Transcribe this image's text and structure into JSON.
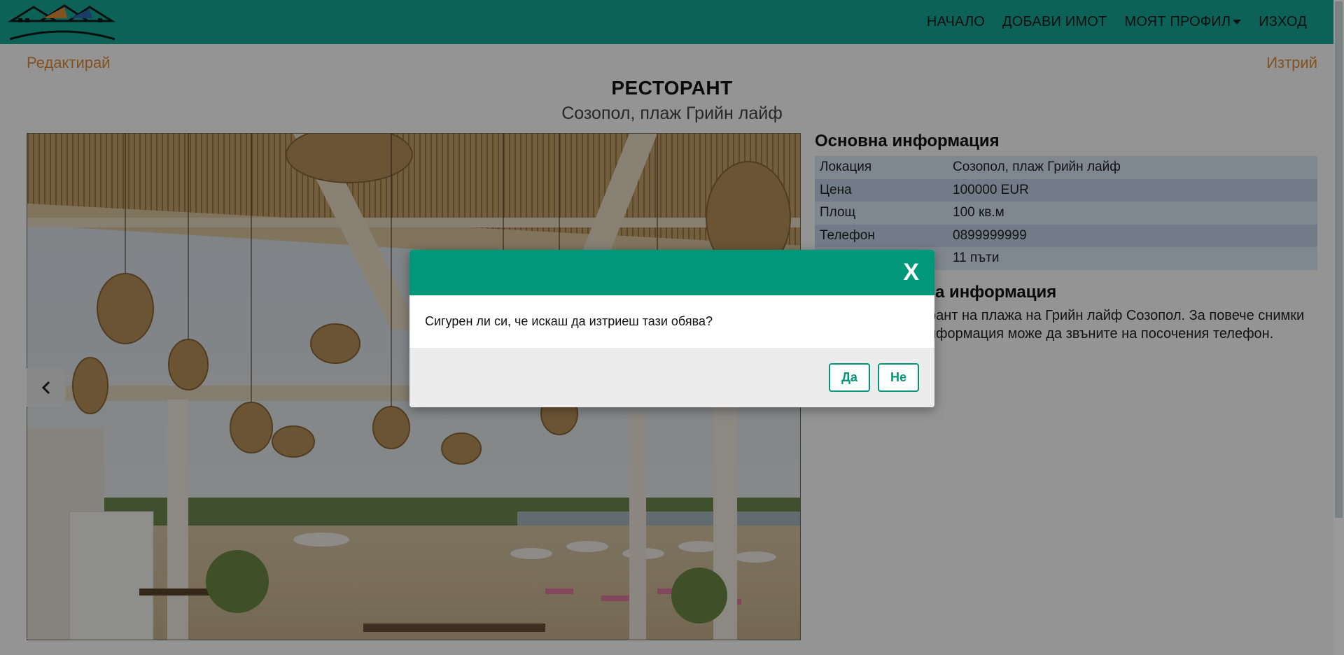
{
  "navbar": {
    "links": [
      "НАЧАЛО",
      "ДОБАВИ ИМОТ",
      "МОЯТ ПРОФИЛ",
      "ИЗХОД"
    ]
  },
  "actions": {
    "edit": "Редактирай",
    "delete": "Изтрий"
  },
  "listing": {
    "title": "РЕСТОРАНТ",
    "subtitle": "Созопол, плаж Грийн лайф"
  },
  "info": {
    "heading": "Основна информация",
    "rows": [
      {
        "key": "Локация",
        "value": "Созопол, плаж Грийн лайф"
      },
      {
        "key": "Цена",
        "value": "100000 EUR"
      },
      {
        "key": "Площ",
        "value": "100 кв.м"
      },
      {
        "key": "Телефон",
        "value": "0899999999"
      },
      {
        "key": "",
        "value": "11 пъти"
      }
    ],
    "second_heading": "а информация",
    "description_lines": [
      "рант на плажа на Грийн лайф Созопол. За повече снимки",
      "нформация може да звъните на посочения телефон."
    ]
  },
  "modal": {
    "close": "X",
    "message": "Сигурен ли си, че искаш да изтриеш тази обява?",
    "yes": "Да",
    "no": "Не"
  }
}
